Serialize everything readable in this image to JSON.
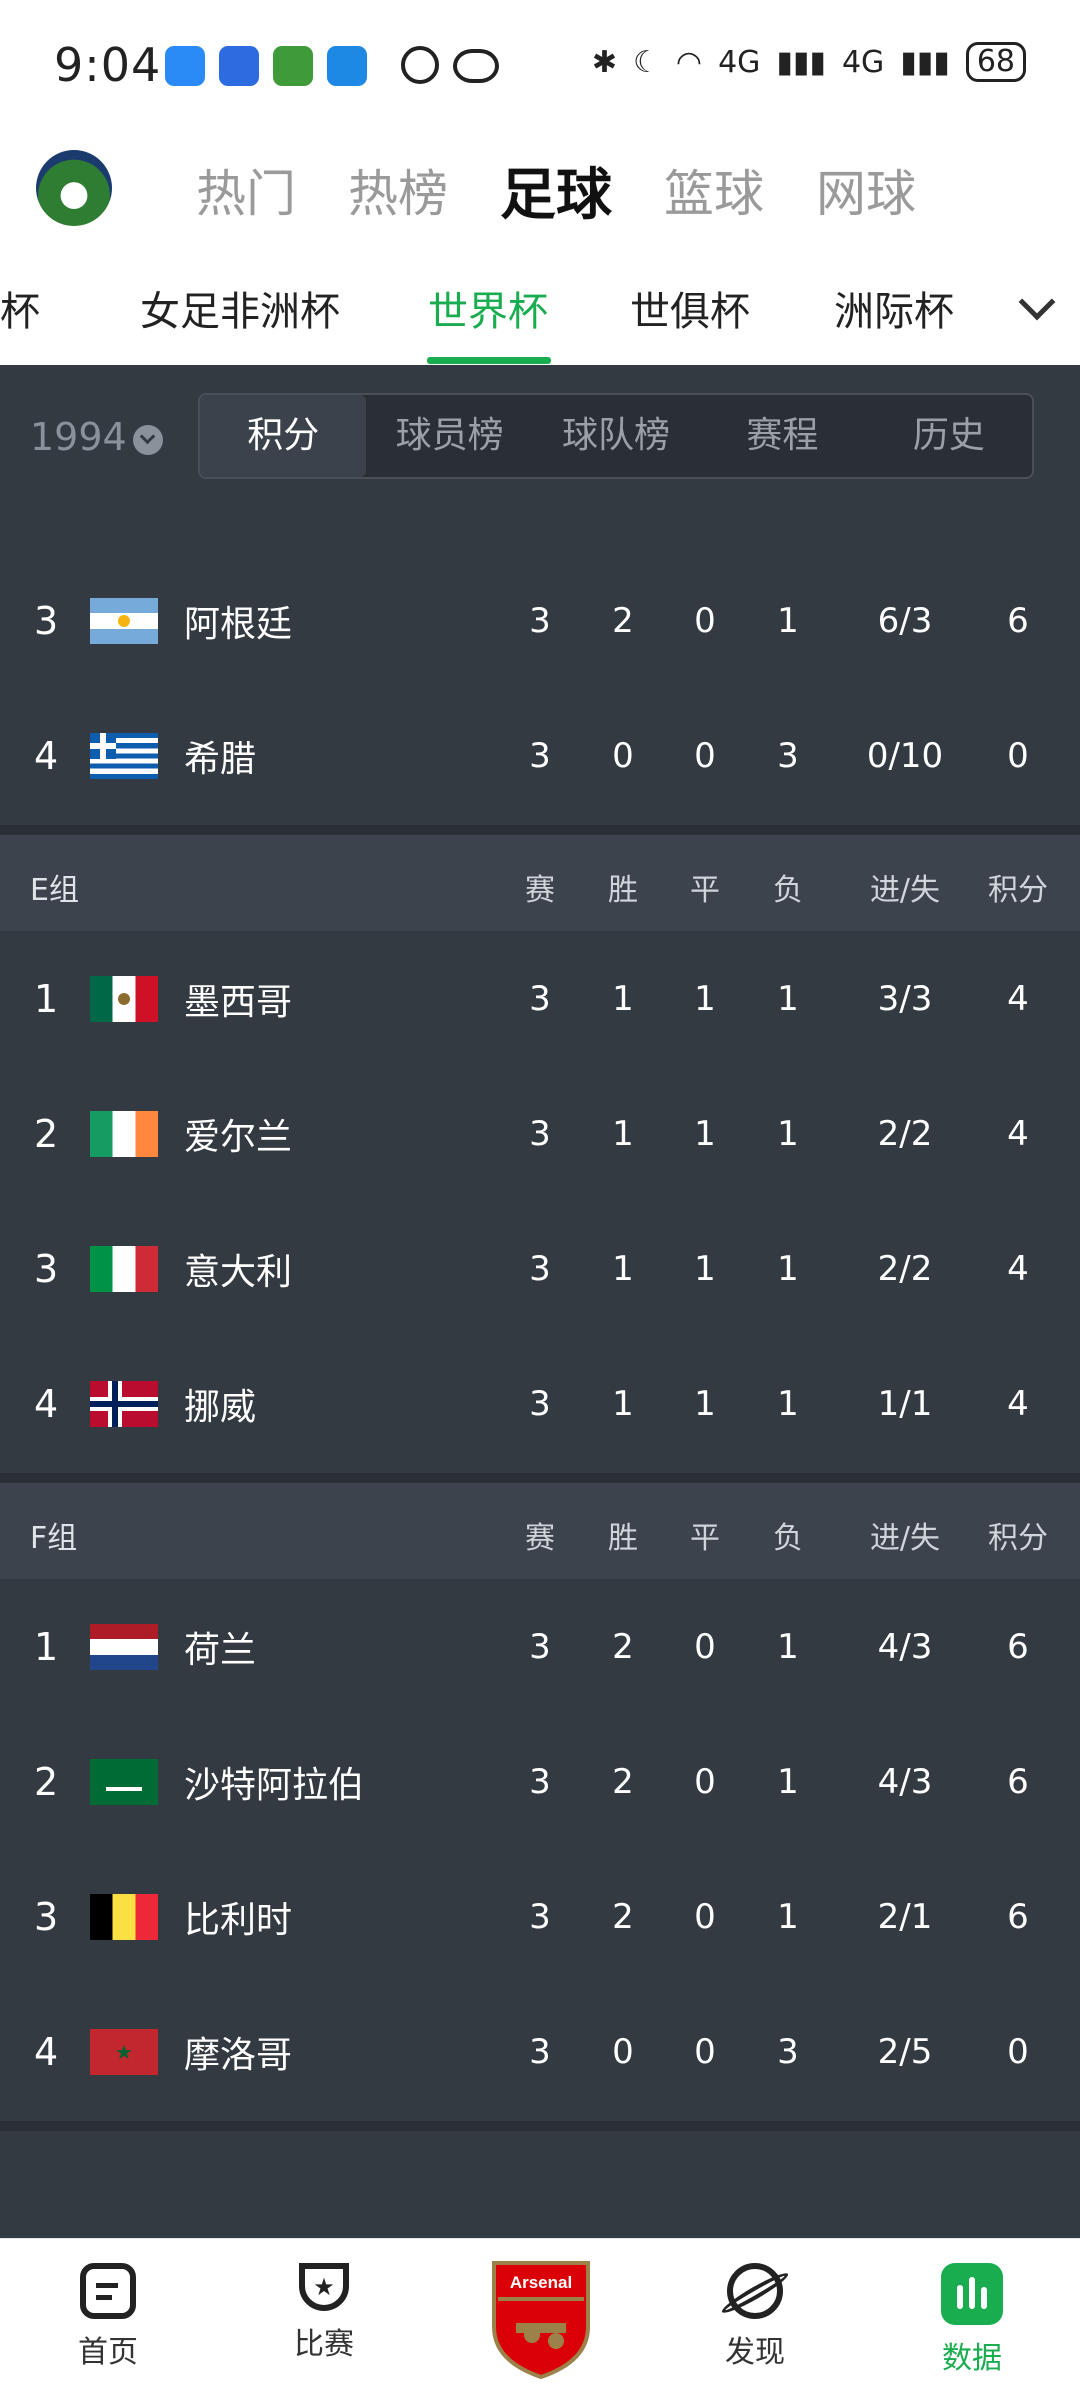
{
  "status": {
    "time": "9:04",
    "network": "4G",
    "battery": "68"
  },
  "header": {
    "tabs": [
      "热门",
      "热榜",
      "足球",
      "篮球",
      "网球"
    ],
    "active": 2
  },
  "subtabs": {
    "items": [
      "洲杯",
      "女足非洲杯",
      "世界杯",
      "世俱杯",
      "洲际杯"
    ],
    "active": 2
  },
  "filter": {
    "year": "1994",
    "segments": [
      "积分",
      "球员榜",
      "球队榜",
      "赛程",
      "历史"
    ],
    "active": 0
  },
  "columns": [
    "赛",
    "胜",
    "平",
    "负",
    "进/失",
    "积分"
  ],
  "group_d_tail": [
    {
      "rank": "3",
      "team": "阿根廷",
      "flag": "argentina",
      "p": "3",
      "w": "2",
      "d": "0",
      "l": "1",
      "gf": "6/3",
      "pts": "6"
    },
    {
      "rank": "4",
      "team": "希腊",
      "flag": "greece",
      "p": "3",
      "w": "0",
      "d": "0",
      "l": "3",
      "gf": "0/10",
      "pts": "0"
    }
  ],
  "group_e": {
    "name": "E组",
    "rows": [
      {
        "rank": "1",
        "team": "墨西哥",
        "flag": "mexico",
        "p": "3",
        "w": "1",
        "d": "1",
        "l": "1",
        "gf": "3/3",
        "pts": "4"
      },
      {
        "rank": "2",
        "team": "爱尔兰",
        "flag": "ireland",
        "p": "3",
        "w": "1",
        "d": "1",
        "l": "1",
        "gf": "2/2",
        "pts": "4"
      },
      {
        "rank": "3",
        "team": "意大利",
        "flag": "italy",
        "p": "3",
        "w": "1",
        "d": "1",
        "l": "1",
        "gf": "2/2",
        "pts": "4"
      },
      {
        "rank": "4",
        "team": "挪威",
        "flag": "norway",
        "p": "3",
        "w": "1",
        "d": "1",
        "l": "1",
        "gf": "1/1",
        "pts": "4"
      }
    ]
  },
  "group_f": {
    "name": "F组",
    "rows": [
      {
        "rank": "1",
        "team": "荷兰",
        "flag": "netherlands",
        "p": "3",
        "w": "2",
        "d": "0",
        "l": "1",
        "gf": "4/3",
        "pts": "6"
      },
      {
        "rank": "2",
        "team": "沙特阿拉伯",
        "flag": "saudi",
        "p": "3",
        "w": "2",
        "d": "0",
        "l": "1",
        "gf": "4/3",
        "pts": "6"
      },
      {
        "rank": "3",
        "team": "比利时",
        "flag": "belgium",
        "p": "3",
        "w": "2",
        "d": "0",
        "l": "1",
        "gf": "2/1",
        "pts": "6"
      },
      {
        "rank": "4",
        "team": "摩洛哥",
        "flag": "morocco",
        "p": "3",
        "w": "0",
        "d": "0",
        "l": "3",
        "gf": "2/5",
        "pts": "0"
      }
    ]
  },
  "bottom_nav": {
    "items": [
      "首页",
      "比赛",
      "",
      "发现",
      "数据"
    ],
    "center_badge": "Arsenal",
    "active": 4
  },
  "colors": {
    "accent": "#1aad50",
    "panel": "#343a42"
  }
}
